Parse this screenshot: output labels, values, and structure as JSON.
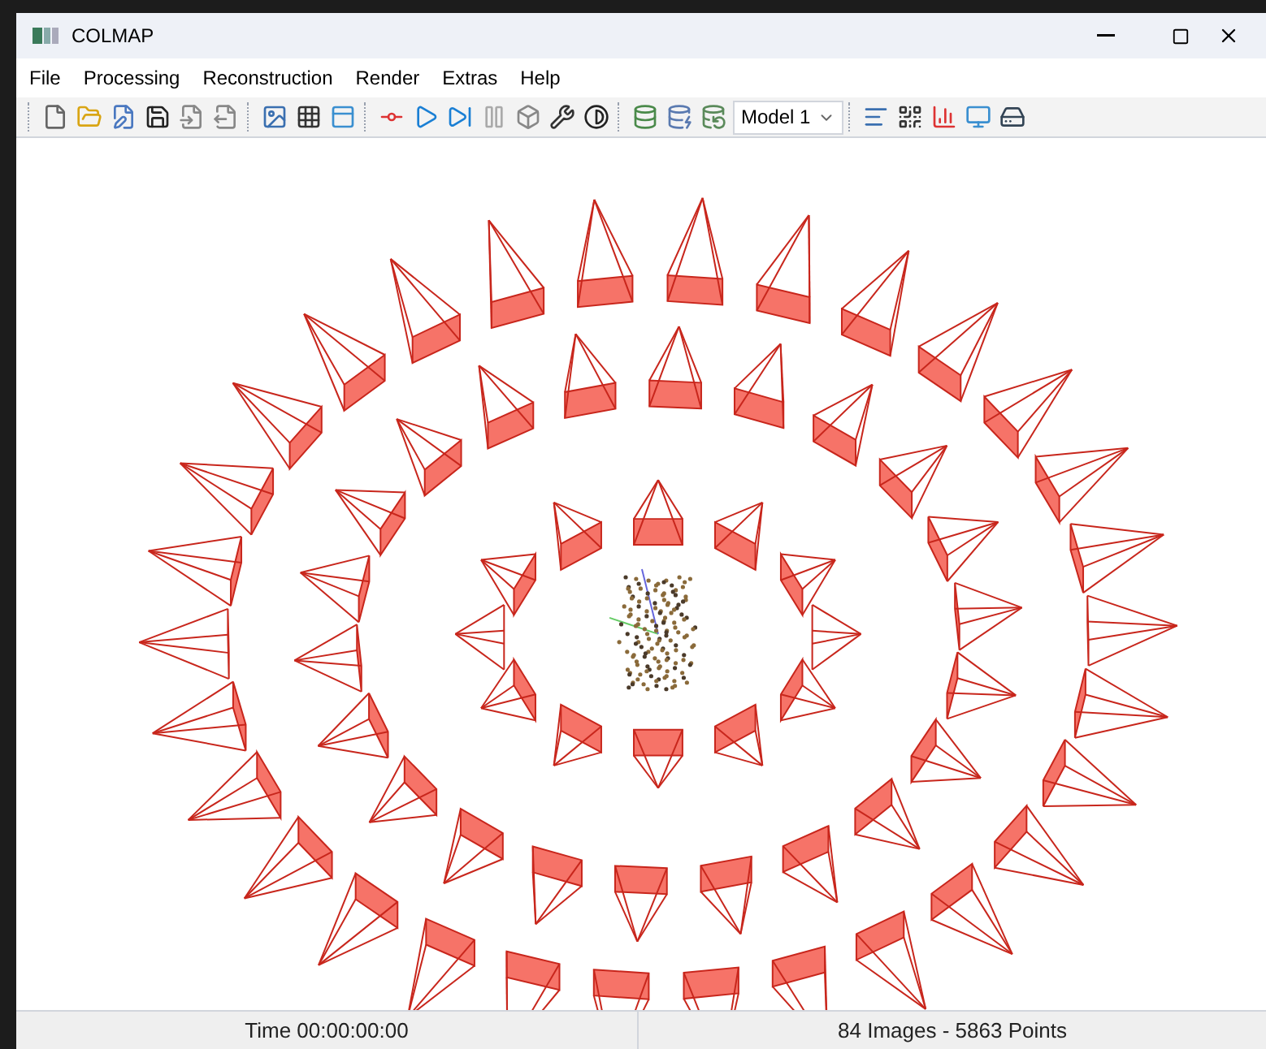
{
  "window": {
    "title": "COLMAP"
  },
  "menu": [
    "File",
    "Processing",
    "Reconstruction",
    "Render",
    "Extras",
    "Help"
  ],
  "toolbar": {
    "model_select": "Model 1"
  },
  "status_bar": [
    "Time 00:00:00:00",
    "84 Images - 5863 Points"
  ]
}
